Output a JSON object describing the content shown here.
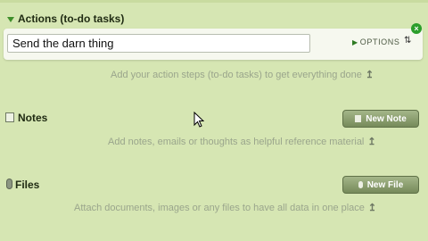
{
  "actions": {
    "title": "Actions (to-do tasks)",
    "task_value": "Send the darn thing",
    "options_label": "OPTIONS",
    "hint": "Add your action steps (to-do tasks) to get everything done"
  },
  "notes": {
    "title": "Notes",
    "button_label": "New Note",
    "hint": "Add notes, emails or thoughts as helpful reference material"
  },
  "files": {
    "title": "Files",
    "button_label": "New File",
    "hint": "Attach documents, images or any files to have all data in one place"
  },
  "colors": {
    "background": "#d6e6b3",
    "button": "#8a9c6e",
    "accent_green": "#2b9e2b",
    "hint_text": "#9aa58c"
  },
  "icons": [
    "chevron-down-icon",
    "close-icon",
    "notes-icon",
    "files-icon",
    "sort-icon",
    "return-arrow-icon",
    "mouse-cursor-icon"
  ]
}
